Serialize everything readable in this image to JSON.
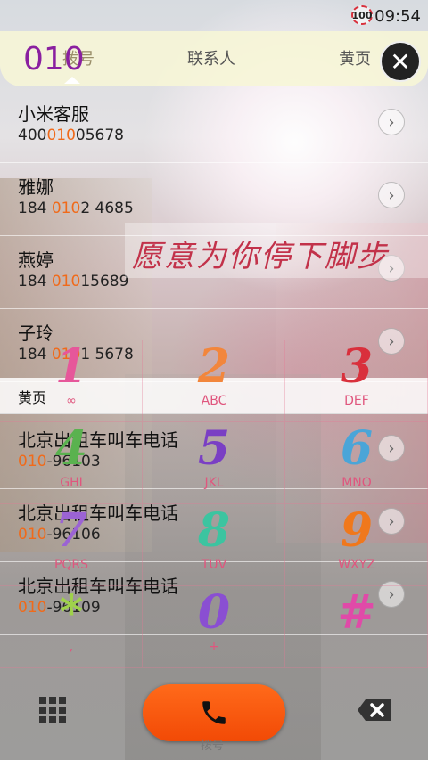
{
  "status": {
    "battery": "100",
    "time": "09:54"
  },
  "header": {
    "digits": "010",
    "tabs": [
      {
        "label": "拨号"
      },
      {
        "label": "联系人"
      },
      {
        "label": "黄页"
      }
    ]
  },
  "results": [
    {
      "name": "小米客服",
      "pre": "400",
      "hl": "010",
      "post": "05678"
    },
    {
      "name": "雅娜",
      "pre": "184 ",
      "hl": "010",
      "post": "2 4685"
    },
    {
      "name": "燕婷",
      "pre": "184 ",
      "hl": "010",
      "post": "15689"
    },
    {
      "name": "子玲",
      "pre": "184 ",
      "hl": "010",
      "post": "1 5678"
    }
  ],
  "yellow_section": {
    "label": "黄页",
    "items": [
      {
        "name": "北京出租车叫车电话",
        "hl": "010",
        "post": "-96103"
      },
      {
        "name": "北京出租车叫车电话",
        "hl": "010",
        "post": "-96106"
      },
      {
        "name": "北京出租车叫车电话",
        "hl": "010",
        "post": "-96109"
      }
    ]
  },
  "banner_text": "愿意为你停下脚步",
  "keypad": [
    {
      "digit": "1",
      "letters": "",
      "color": "#e6579a"
    },
    {
      "digit": "2",
      "letters": "ABC",
      "color": "#f2863c"
    },
    {
      "digit": "3",
      "letters": "DEF",
      "color": "#d9303c"
    },
    {
      "digit": "4",
      "letters": "GHI",
      "color": "#5ab24f"
    },
    {
      "digit": "5",
      "letters": "JKL",
      "color": "#7a3fc4"
    },
    {
      "digit": "6",
      "letters": "MNO",
      "color": "#4aa5d8"
    },
    {
      "digit": "7",
      "letters": "PQRS",
      "color": "#9b63d4"
    },
    {
      "digit": "8",
      "letters": "TUV",
      "color": "#3cc4a0"
    },
    {
      "digit": "9",
      "letters": "WXYZ",
      "color": "#f0781c"
    },
    {
      "digit": "*",
      "letters": ",",
      "color": "#9fd24a"
    },
    {
      "digit": "0",
      "letters": "+",
      "color": "#8a4fd2"
    },
    {
      "digit": "#",
      "letters": "",
      "color": "#e04aa8"
    }
  ],
  "bottom": {
    "call_label": "拨号"
  },
  "colors": {
    "highlight": "#f06a1a",
    "call": "#f24a06",
    "digits": "#8a1fa0"
  }
}
